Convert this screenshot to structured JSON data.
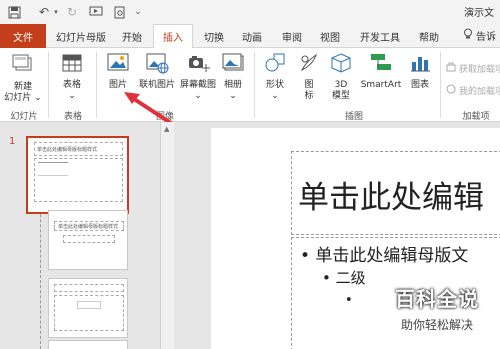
{
  "window_title": "演示文",
  "tabs": [
    "文件",
    "幻灯片母版",
    "开始",
    "插入",
    "切换",
    "动画",
    "审阅",
    "视图",
    "开发工具",
    "帮助"
  ],
  "active_tab": "插入",
  "tell_me": "告诉",
  "ribbon": {
    "new_slide": "新建\n幻灯片",
    "new_slide_1": "新建",
    "new_slide_2": "幻灯片 ⌄",
    "table": "表格",
    "table_arrow": "⌄",
    "picture": "图片",
    "online_picture": "联机图片",
    "screenshot": "屏幕截图",
    "screenshot_arrow": "⌄",
    "album": "相册",
    "album_arrow": "⌄",
    "shapes": "形状",
    "shapes_arrow": "⌄",
    "icons_1": "图",
    "icons_2": "标",
    "model_1": "3D",
    "model_2": "模型",
    "smartart": "SmartArt",
    "chart": "图表",
    "get_addins": "获取加载项",
    "my_addins": "我的加载项",
    "groups": {
      "slides": "幻灯片",
      "tables": "表格",
      "images": "图像",
      "illustrations": "插图",
      "addins": "加载项"
    }
  },
  "slide_number": "1",
  "thumbnails": [
    {
      "title": "单击此处编辑母版标题样式"
    },
    {
      "title": "单击此处编辑母版标题样式"
    }
  ],
  "slide": {
    "title": "单击此处编辑",
    "bullet1": "• 单击此处编辑母版文",
    "bullet2": "• 二级",
    "bullet3": "•"
  },
  "watermark": {
    "main": "百科全说",
    "sub": "助你轻松解决"
  },
  "colors": {
    "accent": "#c43e1c",
    "arrow": "#e0303a"
  }
}
